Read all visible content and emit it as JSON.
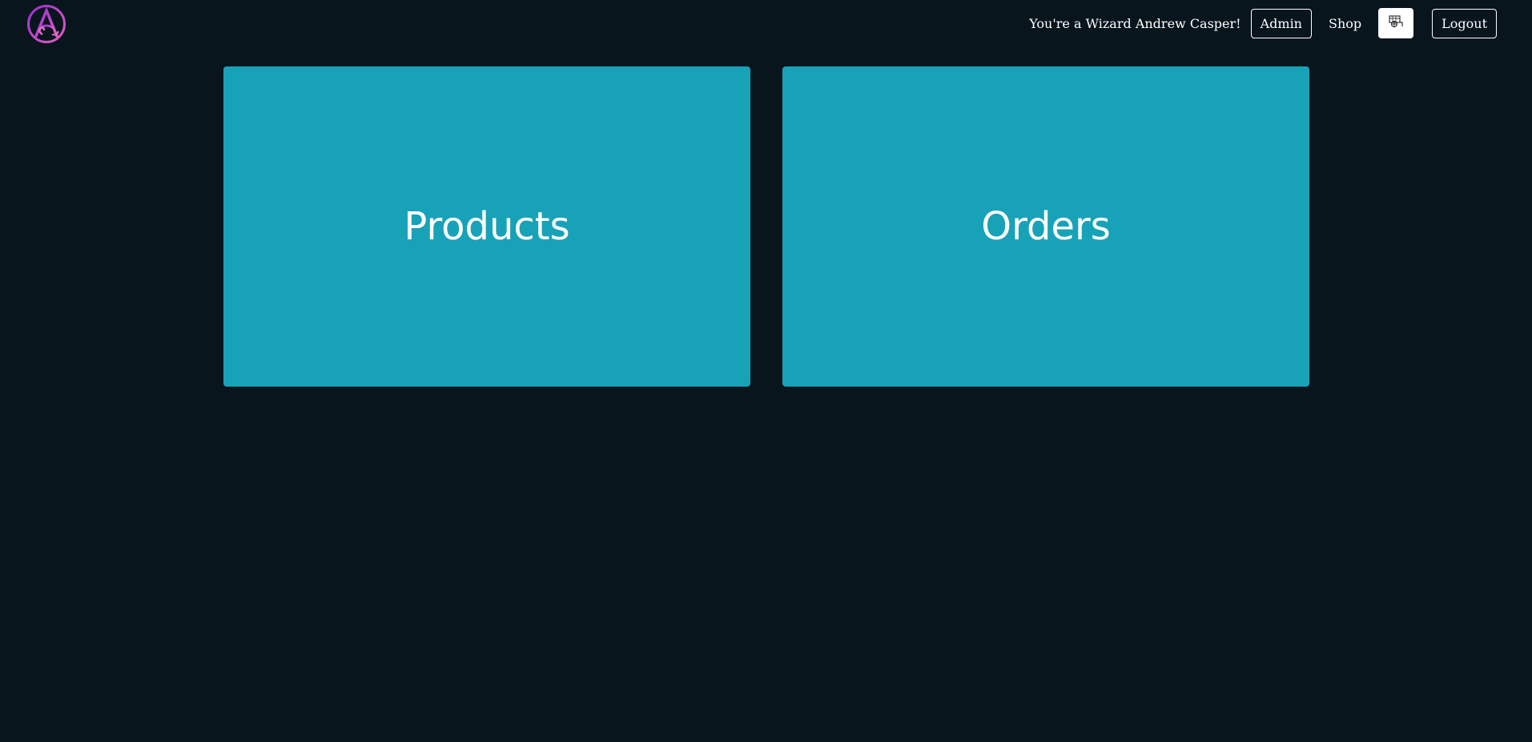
{
  "nav": {
    "logo_icon": "wizard-logo-icon",
    "greeting": "You're a Wizard Andrew Casper!",
    "admin_label": "Admin",
    "shop_label": "Shop",
    "cart_icon": "shopping-cart-icon",
    "logout_label": "Logout"
  },
  "cards": {
    "products_label": "Products",
    "orders_label": "Orders"
  },
  "colors": {
    "background": "#08151d",
    "card": "#18a2b8",
    "text": "#ffffff",
    "logo_accent": "#c040d0"
  }
}
